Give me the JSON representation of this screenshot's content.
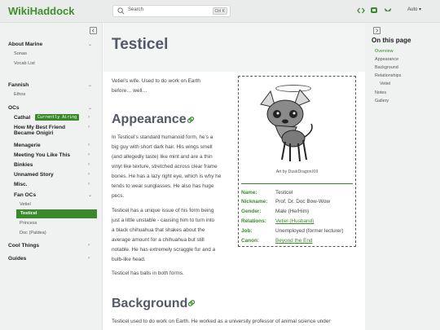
{
  "header": {
    "logo": "WikiHaddock",
    "search_placeholder": "Search",
    "search_shortcut": "Ctrl K",
    "icons": [
      "code-icon",
      "mastodon-icon",
      "bluesky-icon"
    ],
    "theme_label": "Auto"
  },
  "sidebar": {
    "sections": {
      "about_marine": "About Marine",
      "sonas": "Sonas",
      "vocab_list": "Vocab List",
      "fannish": "Fannish",
      "ethos": "Ethos",
      "ocs": "OCs",
      "cathal": "Cathal",
      "currently_airing": "Currently Airing",
      "best_friend_1": "How My Best Friend",
      "best_friend_2": "Became Onigiri",
      "menagerie": "Menagerie",
      "meeting_you": "Meeting You Like This",
      "binkies": "Binkies",
      "unnamed_story": "Unnamed Story",
      "misc": "Misc.",
      "fan_ocs": "Fan OCs",
      "vetiel": "Vetiel",
      "testicel": "Testicel",
      "princess": "Princess",
      "doc": "Doc (Paldea)",
      "cool_things": "Cool Things",
      "guides": "Guides"
    }
  },
  "toc": {
    "heading": "On this page",
    "items": [
      "Overview",
      "Appearance",
      "Background",
      "Relationships",
      "Vetiel",
      "Notes",
      "Gallery"
    ]
  },
  "article": {
    "title": "Testicel",
    "intro_1": "Vetiel’s wife. Used to do work on Earth",
    "intro_2": "before… well…",
    "appearance_heading": "Appearance",
    "appearance_lines": [
      "In Testicel’s standard humanoid form, he’s a",
      "big guy with short dark hair. His wings smell",
      "(and allegedly taste) like mint and are a thin",
      "vinyl like texture, stretched across clear frame",
      "bones. He has a lazy right eye, which is why he",
      "tends to wear sunglasses. He also has huge",
      "pecs."
    ],
    "form_lines": [
      "Testicel has a unique issue of his form being",
      "just a little unstable - causing him to turn into",
      "a black chihuahua that shakes about the",
      "average amount for a chihuahua but still",
      "notable. He has extremely scraggle fur and a",
      "bulb-like head."
    ],
    "balls": "Testicel has balls in both forms.",
    "background_heading": "Background",
    "background_1": "Testicel used to do work on Earth. He worked as a university professor of animal science under"
  },
  "infobox": {
    "caption": "Art by DuskDragonXIII",
    "rows": [
      {
        "key": "Name:",
        "value": "Testicel"
      },
      {
        "key": "Nickname:",
        "value": "Prof. Dr. Doc Bow-Wow"
      },
      {
        "key": "Gender:",
        "value": "Male (He/Him)"
      },
      {
        "key": "Relations:",
        "value": "Vetiel (Husband)"
      },
      {
        "key": "Job:",
        "value": "Unemployed (former lecturer)"
      },
      {
        "key": "Canon:",
        "value": "Beyond the End"
      }
    ]
  },
  "colors": {
    "accent": "#3a8a2c",
    "heading": "#545968",
    "sidebar_bg": "#f0f1f1"
  }
}
